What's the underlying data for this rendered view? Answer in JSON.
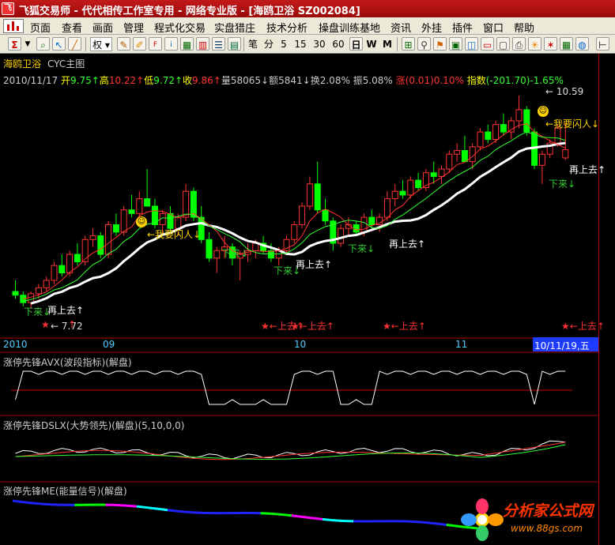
{
  "window": {
    "title": "飞狐交易师 - 代代相传工作室专用 - 网络专业版 - [海鸥卫浴 SZ002084]"
  },
  "menu": [
    "页面",
    "查看",
    "画面",
    "管理",
    "程式化交易",
    "实盘猎庄",
    "技术分析",
    "操盘训练基地",
    "资讯",
    "外挂",
    "插件",
    "窗口",
    "帮助"
  ],
  "toolbar": {
    "quan": "权",
    "periods": [
      "笔",
      "分",
      "5",
      "15",
      "30",
      "60",
      "日",
      "W",
      "M"
    ]
  },
  "main": {
    "stock_name": "海鸥卫浴",
    "indicator": "CYC主图",
    "date": "2010/11/17",
    "quote": {
      "open_label": "开",
      "open": "9.75",
      "high_label": "高",
      "high": "10.22",
      "low_label": "低",
      "low": "9.72",
      "close_label": "收",
      "close": "9.86",
      "volume_label": "量",
      "volume": "58065",
      "amount_label": "额",
      "amount": "5841",
      "turnover_label": "换",
      "turnover": "2.08%",
      "amplitude_label": "振",
      "amplitude": "5.08%",
      "change_label": "涨",
      "change": "(0.01)0.10%",
      "index_label": "指数",
      "index": "(-201.70)-1.65%"
    },
    "price_high_label": "10.59",
    "price_low_label": "7.72",
    "annotations": {
      "flash": "←我要闪人↓",
      "up_again": "再上去↑",
      "down": "下来↓",
      "up": "←上去↑"
    },
    "date_axis": [
      "2010",
      "09",
      "10",
      "11"
    ],
    "cursor_date": "10/11/19,五"
  },
  "panels": [
    {
      "title": "涨停先锋AVX(波段指标)(解盘)"
    },
    {
      "title": "涨停先锋DSLX(大势领先)(解盘)(5,10,0,0)"
    },
    {
      "title": "涨停先锋ME(能量信号)(解盘)"
    }
  ],
  "watermark": {
    "title": "分析家公式网",
    "url": "www.88gs.com"
  },
  "colors": {
    "up": "#ff3333",
    "down": "#00ff00",
    "ma": "#ffffff",
    "title_bar": "#b01010"
  },
  "chart_data": {
    "type": "candlestick",
    "candles": [
      [
        7.95,
        8.1,
        7.85,
        7.9
      ],
      [
        7.9,
        7.95,
        7.75,
        7.8
      ],
      [
        7.8,
        7.95,
        7.72,
        7.92
      ],
      [
        7.92,
        8.05,
        7.85,
        8.0
      ],
      [
        8.0,
        8.15,
        7.95,
        8.1
      ],
      [
        8.1,
        8.35,
        8.05,
        8.3
      ],
      [
        8.3,
        8.45,
        8.15,
        8.2
      ],
      [
        8.2,
        8.5,
        8.15,
        8.45
      ],
      [
        8.45,
        8.6,
        8.3,
        8.35
      ],
      [
        8.35,
        8.7,
        8.3,
        8.65
      ],
      [
        8.65,
        8.8,
        8.55,
        8.7
      ],
      [
        8.7,
        8.75,
        8.4,
        8.45
      ],
      [
        8.45,
        8.9,
        8.4,
        8.85
      ],
      [
        8.85,
        9.0,
        8.7,
        8.75
      ],
      [
        8.75,
        9.1,
        8.7,
        9.05
      ],
      [
        9.05,
        9.25,
        8.95,
        9.0
      ],
      [
        9.0,
        9.3,
        8.9,
        9.2
      ],
      [
        9.2,
        9.6,
        9.15,
        9.1
      ],
      [
        9.1,
        9.2,
        8.8,
        8.85
      ],
      [
        8.85,
        9.05,
        8.7,
        9.0
      ],
      [
        9.0,
        9.1,
        8.75,
        8.8
      ],
      [
        8.8,
        9.0,
        8.7,
        8.95
      ],
      [
        8.95,
        9.4,
        8.9,
        9.3
      ],
      [
        9.3,
        9.35,
        8.9,
        8.95
      ],
      [
        8.95,
        9.1,
        8.6,
        8.65
      ],
      [
        8.65,
        8.75,
        8.35,
        8.4
      ],
      [
        8.4,
        8.55,
        8.2,
        8.5
      ],
      [
        8.5,
        8.7,
        8.4,
        8.55
      ],
      [
        8.55,
        8.6,
        8.3,
        8.4
      ],
      [
        8.4,
        8.5,
        8.1,
        8.45
      ],
      [
        8.45,
        8.6,
        8.35,
        8.5
      ],
      [
        8.5,
        8.65,
        8.4,
        8.6
      ],
      [
        8.6,
        8.7,
        8.45,
        8.5
      ],
      [
        8.5,
        8.6,
        8.35,
        8.4
      ],
      [
        8.4,
        8.55,
        8.3,
        8.5
      ],
      [
        8.5,
        8.7,
        8.45,
        8.65
      ],
      [
        8.65,
        8.9,
        8.6,
        8.85
      ],
      [
        8.85,
        9.15,
        8.8,
        9.1
      ],
      [
        9.1,
        9.5,
        9.05,
        9.4
      ],
      [
        9.4,
        9.7,
        9.0,
        9.05
      ],
      [
        9.05,
        9.2,
        8.85,
        8.9
      ],
      [
        8.9,
        8.95,
        8.5,
        8.6
      ],
      [
        8.6,
        8.85,
        8.55,
        8.8
      ],
      [
        8.8,
        8.95,
        8.7,
        8.85
      ],
      [
        8.85,
        8.9,
        8.7,
        8.75
      ],
      [
        8.75,
        9.0,
        8.7,
        8.95
      ],
      [
        8.95,
        9.05,
        8.8,
        8.85
      ],
      [
        8.85,
        9.0,
        8.75,
        8.95
      ],
      [
        8.95,
        9.3,
        8.9,
        9.2
      ],
      [
        9.2,
        9.4,
        9.1,
        9.3
      ],
      [
        9.3,
        9.45,
        9.2,
        9.25
      ],
      [
        9.25,
        9.5,
        9.2,
        9.45
      ],
      [
        9.45,
        9.55,
        9.3,
        9.35
      ],
      [
        9.35,
        9.6,
        9.3,
        9.55
      ],
      [
        9.55,
        9.7,
        9.4,
        9.5
      ],
      [
        9.5,
        9.65,
        9.4,
        9.6
      ],
      [
        9.6,
        9.85,
        9.55,
        9.8
      ],
      [
        9.8,
        9.95,
        9.7,
        9.85
      ],
      [
        9.85,
        10.05,
        9.75,
        9.7
      ],
      [
        9.7,
        9.95,
        9.6,
        9.9
      ],
      [
        9.9,
        10.15,
        9.85,
        10.1
      ],
      [
        10.1,
        10.2,
        9.95,
        10.0
      ],
      [
        10.0,
        10.25,
        9.95,
        10.2
      ],
      [
        10.2,
        10.35,
        10.05,
        10.1
      ],
      [
        10.1,
        10.3,
        10.0,
        10.25
      ],
      [
        10.25,
        10.59,
        10.15,
        10.4
      ],
      [
        10.4,
        10.45,
        10.05,
        10.1
      ],
      [
        10.1,
        10.15,
        9.6,
        9.65
      ],
      [
        9.65,
        9.85,
        9.4,
        9.8
      ],
      [
        9.8,
        10.0,
        9.75,
        9.95
      ],
      [
        9.95,
        10.2,
        9.9,
        10.15
      ],
      [
        9.75,
        10.22,
        9.72,
        9.86
      ]
    ],
    "ymin": 7.45,
    "ymax": 10.75
  }
}
